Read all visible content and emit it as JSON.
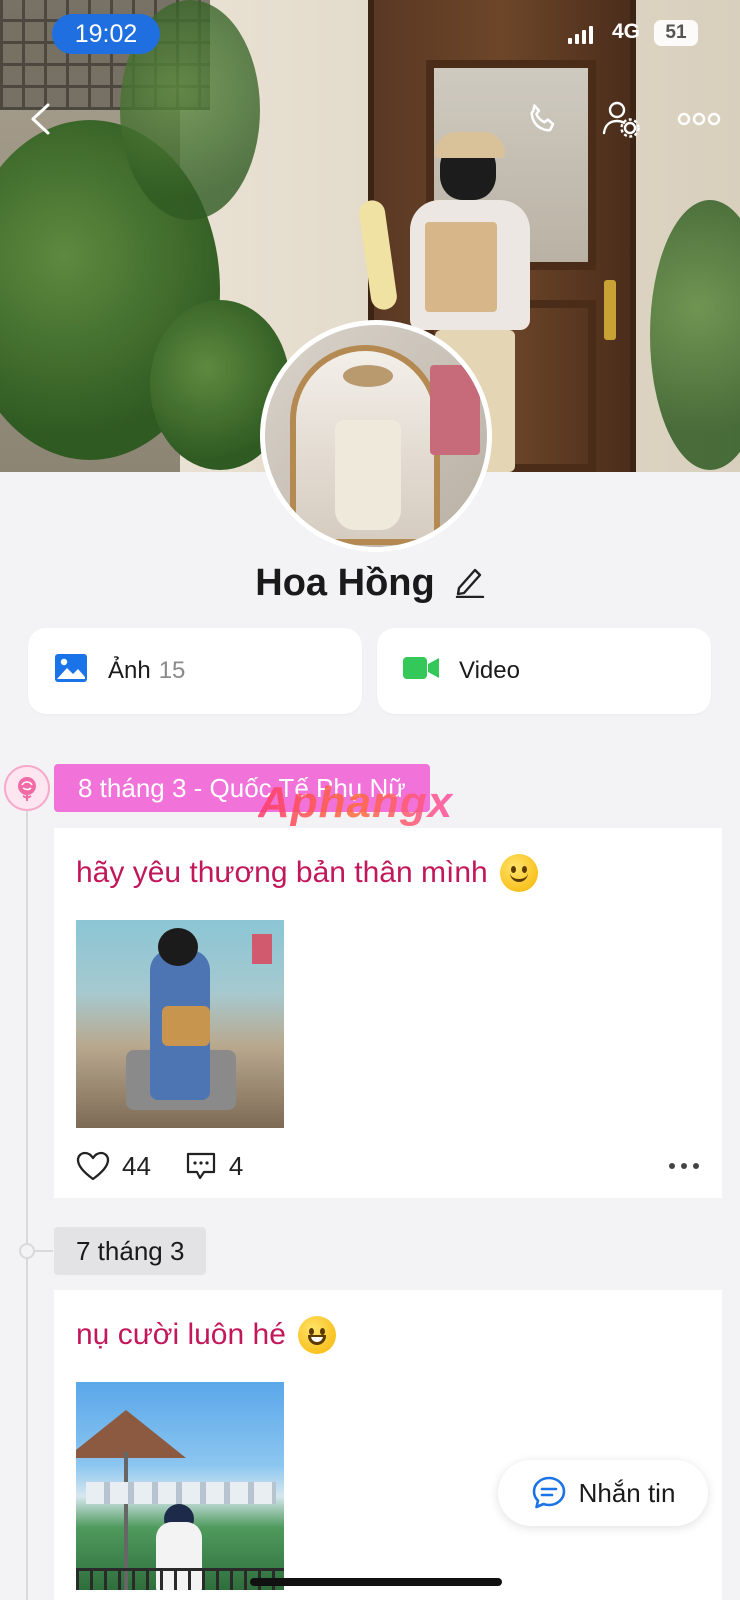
{
  "status_bar": {
    "time": "19:02",
    "network": "4G",
    "battery": "51"
  },
  "profile": {
    "name": "Hoa Hồng"
  },
  "media": {
    "photos_label": "Ảnh",
    "photos_count": "15",
    "video_label": "Video"
  },
  "watermark": "Aphangx",
  "timeline": [
    {
      "date": "8 tháng 3 - Quốc Tế Phụ Nữ",
      "text": "hãy yêu thương bản thân mình",
      "likes": "44",
      "comments": "4"
    },
    {
      "date": "7 tháng 3",
      "text": "nụ cười luôn hé"
    }
  ],
  "fab": {
    "label": "Nhắn tin"
  },
  "colors": {
    "accent_blue": "#1f6fe0",
    "pink_pill": "#f172d8",
    "post_text": "#c2185b",
    "video_green": "#34c759"
  },
  "icons": [
    "back-icon",
    "phone-icon",
    "user-settings-icon",
    "more-icon",
    "edit-icon",
    "image-icon",
    "video-icon",
    "rose-icon",
    "heart-icon",
    "comment-icon",
    "message-icon"
  ]
}
